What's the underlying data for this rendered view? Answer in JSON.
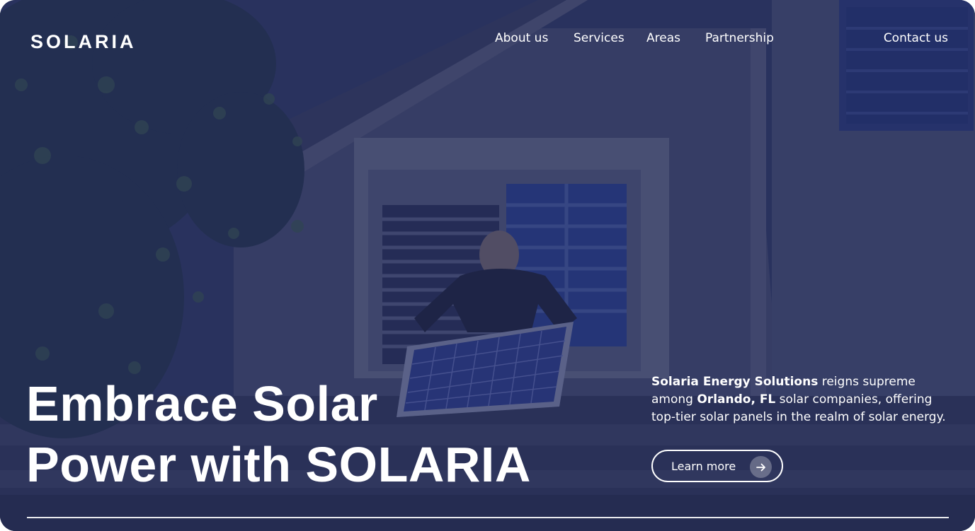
{
  "brand": {
    "logo": "SOLARIA"
  },
  "nav": {
    "items": [
      {
        "label": "About us"
      },
      {
        "label": "Services"
      },
      {
        "label": "Areas"
      },
      {
        "label": "Partnership"
      }
    ],
    "contact_label": "Contact us"
  },
  "hero": {
    "headline_line1": "Embrace Solar",
    "headline_line2": "Power with SOLARIA",
    "tagline": {
      "company": "Solaria Energy Solutions",
      "text1": " reigns supreme among ",
      "location": "Orlando, FL",
      "text2": " solar companies, offering top-tier solar panels in the realm of solar energy."
    },
    "cta_label": "Learn more",
    "cta_icon": "arrow-right-icon"
  },
  "colors": {
    "overlay": "#1f2a5c",
    "text": "#ffffff"
  }
}
